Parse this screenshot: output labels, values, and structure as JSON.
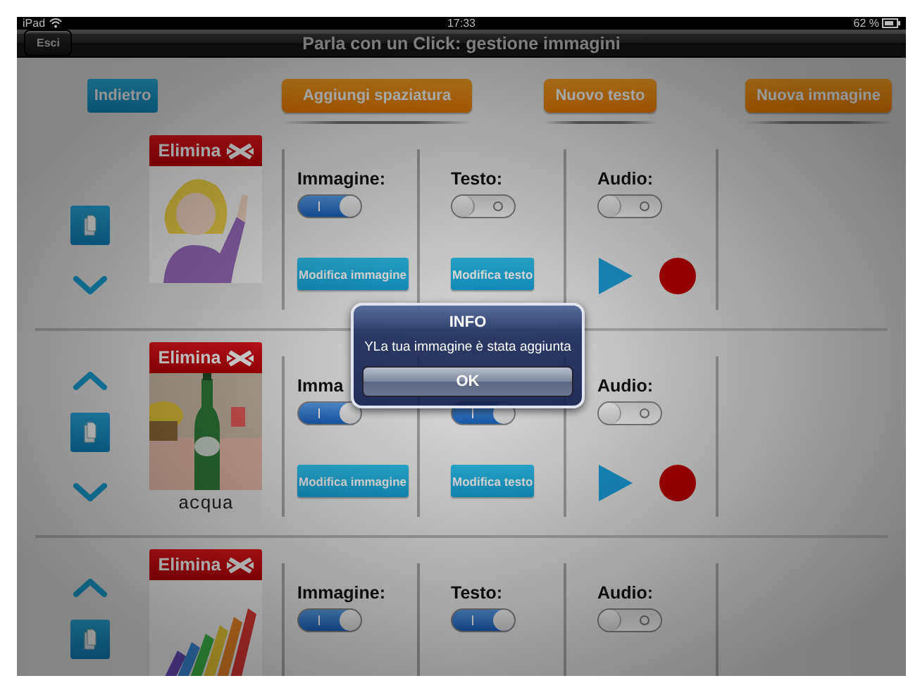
{
  "status_bar": {
    "device": "iPad",
    "time": "17:33",
    "battery": "62 %"
  },
  "nav_bar": {
    "back_button": "Esci",
    "title": "Parla con un Click: gestione immagini"
  },
  "toolbar": [
    {
      "label": "Indietro",
      "kind": "back"
    },
    {
      "label": "Aggiungi spaziatura",
      "kind": "action"
    },
    {
      "label": "Nuovo testo",
      "kind": "action"
    },
    {
      "label": "Nuova immagine",
      "kind": "action"
    }
  ],
  "rows": [
    {
      "delete_label": "Elimina",
      "can_move_up": false,
      "can_move_down": true,
      "sections": [
        {
          "label": "Immagine:",
          "on": true,
          "button": "Modifica immagine"
        },
        {
          "kind": "text",
          "label": "Testo:",
          "on": false,
          "button": "Modifica testo"
        },
        {
          "kind": "audio",
          "label": "Audio:",
          "on": false,
          "player": true
        }
      ]
    },
    {
      "delete_label": "Elimina",
      "caption": "acqua",
      "can_move_up": true,
      "can_move_down": true,
      "sections": [
        {
          "label": "Imma",
          "on": true,
          "button": "Modifica immagine"
        },
        {
          "kind": "text",
          "on": true,
          "button": "Modifica testo"
        },
        {
          "kind": "audio",
          "label": "Audio:",
          "on": false,
          "player": true
        }
      ]
    },
    {
      "delete_label": "Elimina",
      "can_move_up": true,
      "can_move_down": false,
      "sections": [
        {
          "label": "Immagine:",
          "on": true
        },
        {
          "kind": "text",
          "label": "Testo:",
          "on": true
        },
        {
          "kind": "audio",
          "label": "Audio:",
          "on": false,
          "player": false
        }
      ]
    }
  ],
  "alert": {
    "title": "INFO",
    "message": "YLa tua immagine è stata aggiunta",
    "button": "OK"
  }
}
